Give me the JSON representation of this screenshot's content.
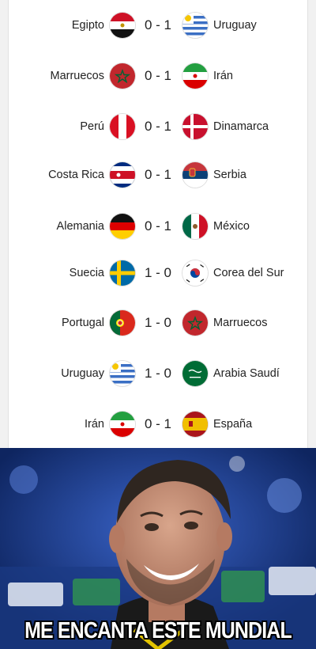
{
  "matches": [
    {
      "home": "Egipto",
      "score": "0 - 1",
      "away": "Uruguay",
      "home_flag": "egypt-flag-icon",
      "away_flag": "uruguay-flag-icon"
    },
    {
      "home": "Marruecos",
      "score": "0 - 1",
      "away": "Irán",
      "home_flag": "morocco-flag-icon",
      "away_flag": "iran-flag-icon"
    },
    {
      "home": "Perú",
      "score": "0 - 1",
      "away": "Dinamarca",
      "home_flag": "peru-flag-icon",
      "away_flag": "denmark-flag-icon"
    },
    {
      "home": "Costa Rica",
      "score": "0 - 1",
      "away": "Serbia",
      "home_flag": "costa-rica-flag-icon",
      "away_flag": "serbia-flag-icon"
    },
    {
      "home": "Alemania",
      "score": "0 - 1",
      "away": "México",
      "home_flag": "germany-flag-icon",
      "away_flag": "mexico-flag-icon"
    },
    {
      "home": "Suecia",
      "score": "1 - 0",
      "away": "Corea del Sur",
      "home_flag": "sweden-flag-icon",
      "away_flag": "south-korea-flag-icon"
    },
    {
      "home": "Portugal",
      "score": "1 - 0",
      "away": "Marruecos",
      "home_flag": "portugal-flag-icon",
      "away_flag": "morocco-flag-icon"
    },
    {
      "home": "Uruguay",
      "score": "1 - 0",
      "away": "Arabia Saudí",
      "home_flag": "uruguay-flag-icon",
      "away_flag": "saudi-arabia-flag-icon"
    },
    {
      "home": "Irán",
      "score": "0 - 1",
      "away": "España",
      "home_flag": "iran-flag-icon",
      "away_flag": "spain-flag-icon"
    }
  ],
  "meme": {
    "caption": "ME ENCANTA ESTE MUNDIAL",
    "background_color": "#1c3f8f"
  }
}
